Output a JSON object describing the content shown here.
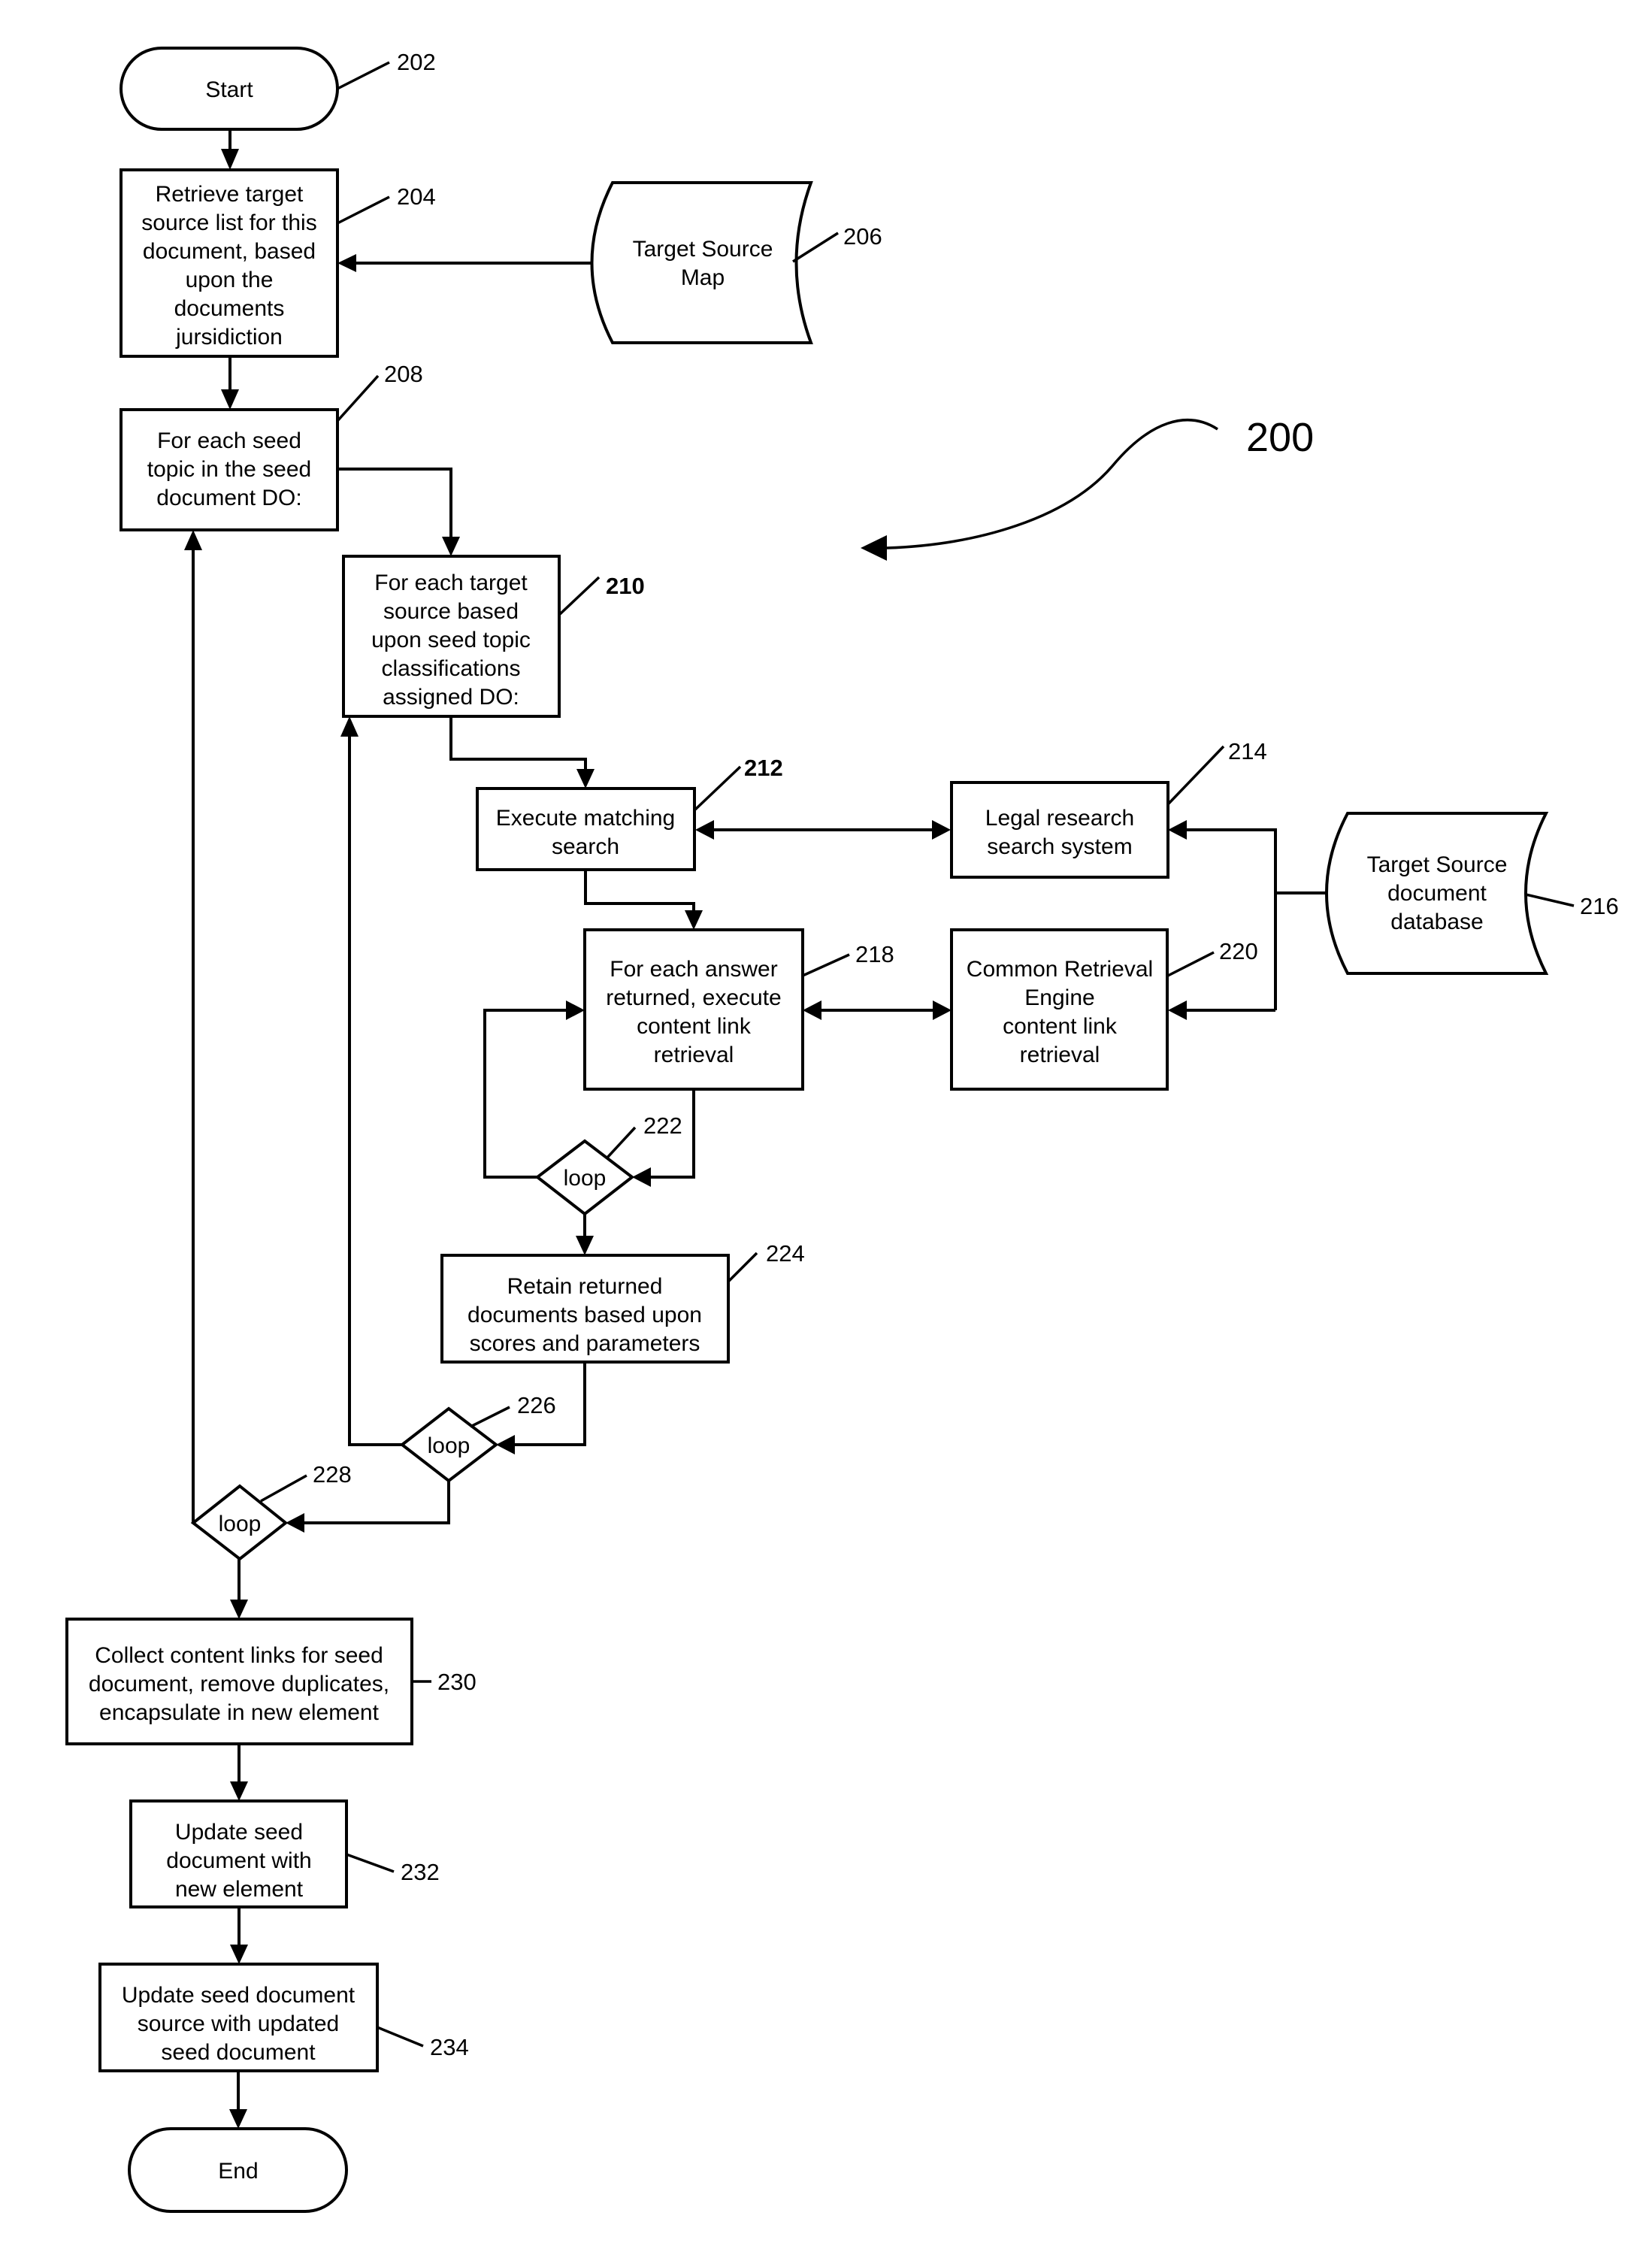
{
  "figure": {
    "ref": "200",
    "colors": {
      "ink": "#000000",
      "paper": "#ffffff"
    }
  },
  "nodes": {
    "n202": {
      "ref": "202",
      "type": "terminator",
      "lines": [
        "Start"
      ]
    },
    "n204": {
      "ref": "204",
      "type": "process",
      "lines": [
        "Retrieve target",
        "source list for this",
        "document, based",
        "upon the",
        "documents",
        "jursidiction"
      ]
    },
    "n206": {
      "ref": "206",
      "type": "data-store",
      "lines": [
        "Target Source",
        "Map"
      ]
    },
    "n208": {
      "ref": "208",
      "type": "process",
      "lines": [
        "For each seed",
        "topic in the seed",
        "document DO:"
      ]
    },
    "n210": {
      "ref": "210",
      "type": "process",
      "lines": [
        "For each target",
        "source based",
        "upon seed topic",
        "classifications",
        "assigned DO:"
      ]
    },
    "n212": {
      "ref": "212",
      "type": "process",
      "lines": [
        "Execute matching",
        "search"
      ]
    },
    "n214": {
      "ref": "214",
      "type": "process",
      "lines": [
        "Legal research",
        "search system"
      ]
    },
    "n216": {
      "ref": "216",
      "type": "data-store",
      "lines": [
        "Target Source",
        "document",
        "database"
      ]
    },
    "n218": {
      "ref": "218",
      "type": "process",
      "lines": [
        "For each answer",
        "returned, execute",
        "content link",
        "retrieval"
      ]
    },
    "n220": {
      "ref": "220",
      "type": "process",
      "lines": [
        "Common Retrieval",
        "Engine",
        "content link",
        "retrieval"
      ]
    },
    "n222": {
      "ref": "222",
      "type": "decision",
      "lines": [
        "loop"
      ]
    },
    "n224": {
      "ref": "224",
      "type": "process",
      "lines": [
        "Retain returned",
        "documents based upon",
        "scores and parameters"
      ]
    },
    "n226": {
      "ref": "226",
      "type": "decision",
      "lines": [
        "loop"
      ]
    },
    "n228": {
      "ref": "228",
      "type": "decision",
      "lines": [
        "loop"
      ]
    },
    "n230": {
      "ref": "230",
      "type": "process",
      "lines": [
        "Collect content links for seed",
        "document, remove duplicates,",
        "encapsulate in new element"
      ]
    },
    "n232": {
      "ref": "232",
      "type": "process",
      "lines": [
        "Update seed",
        "document with",
        "new element"
      ]
    },
    "n234": {
      "ref": "234",
      "type": "process",
      "lines": [
        "Update seed document",
        "source with updated",
        "seed document"
      ]
    },
    "n236": {
      "type": "terminator",
      "lines": [
        "End"
      ]
    }
  },
  "edges": [
    {
      "from": "202",
      "to": "204"
    },
    {
      "from": "206",
      "to": "204"
    },
    {
      "from": "204",
      "to": "208"
    },
    {
      "from": "208",
      "to": "210"
    },
    {
      "from": "210",
      "to": "212"
    },
    {
      "from": "212",
      "to": "214",
      "bidirectional": true
    },
    {
      "from": "216",
      "to": "214"
    },
    {
      "from": "216",
      "to": "220"
    },
    {
      "from": "212",
      "to": "218"
    },
    {
      "from": "218",
      "to": "220",
      "bidirectional": true
    },
    {
      "from": "218",
      "to": "222"
    },
    {
      "from": "222",
      "to": "218",
      "label": "loop back"
    },
    {
      "from": "222",
      "to": "224"
    },
    {
      "from": "224",
      "to": "226"
    },
    {
      "from": "226",
      "to": "210",
      "label": "loop back"
    },
    {
      "from": "226",
      "to": "228"
    },
    {
      "from": "228",
      "to": "208",
      "label": "loop back"
    },
    {
      "from": "228",
      "to": "230"
    },
    {
      "from": "230",
      "to": "232"
    },
    {
      "from": "232",
      "to": "234"
    },
    {
      "from": "234",
      "to": "End"
    }
  ]
}
